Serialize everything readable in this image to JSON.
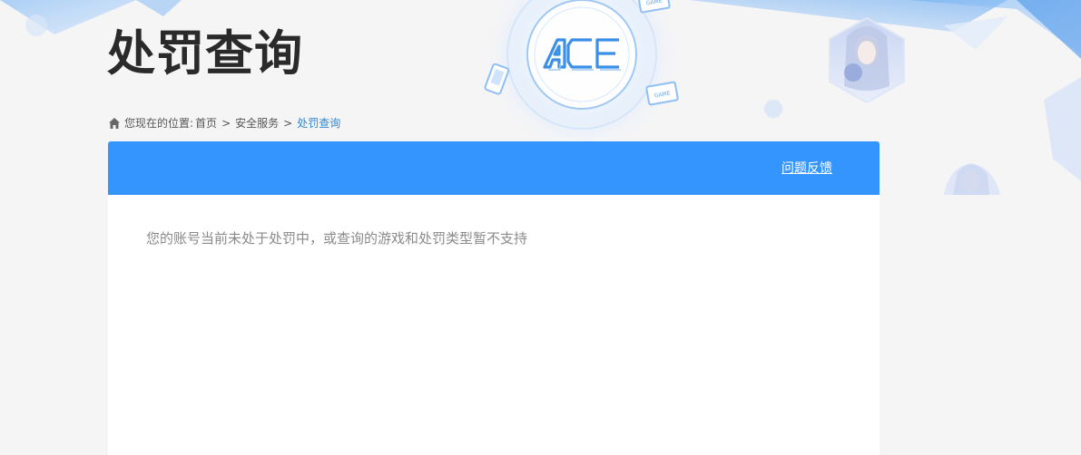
{
  "page": {
    "title": "处罚查询",
    "logo_text": "ACE",
    "decor_badge_text": "GAME"
  },
  "breadcrumb": {
    "prefix": "您现在的位置:",
    "separator": ">",
    "items": [
      {
        "label": "首页"
      },
      {
        "label": "安全服务"
      },
      {
        "label": "处罚查询"
      }
    ]
  },
  "panel": {
    "feedback_label": "问题反馈",
    "message": "您的账号当前未处于处罚中，或查询的游戏和处罚类型暂不支持"
  },
  "colors": {
    "accent": "#3595ff",
    "breadcrumb_current": "#2f86d4",
    "background": "#f5f5f6",
    "title": "#2a2a2a"
  }
}
